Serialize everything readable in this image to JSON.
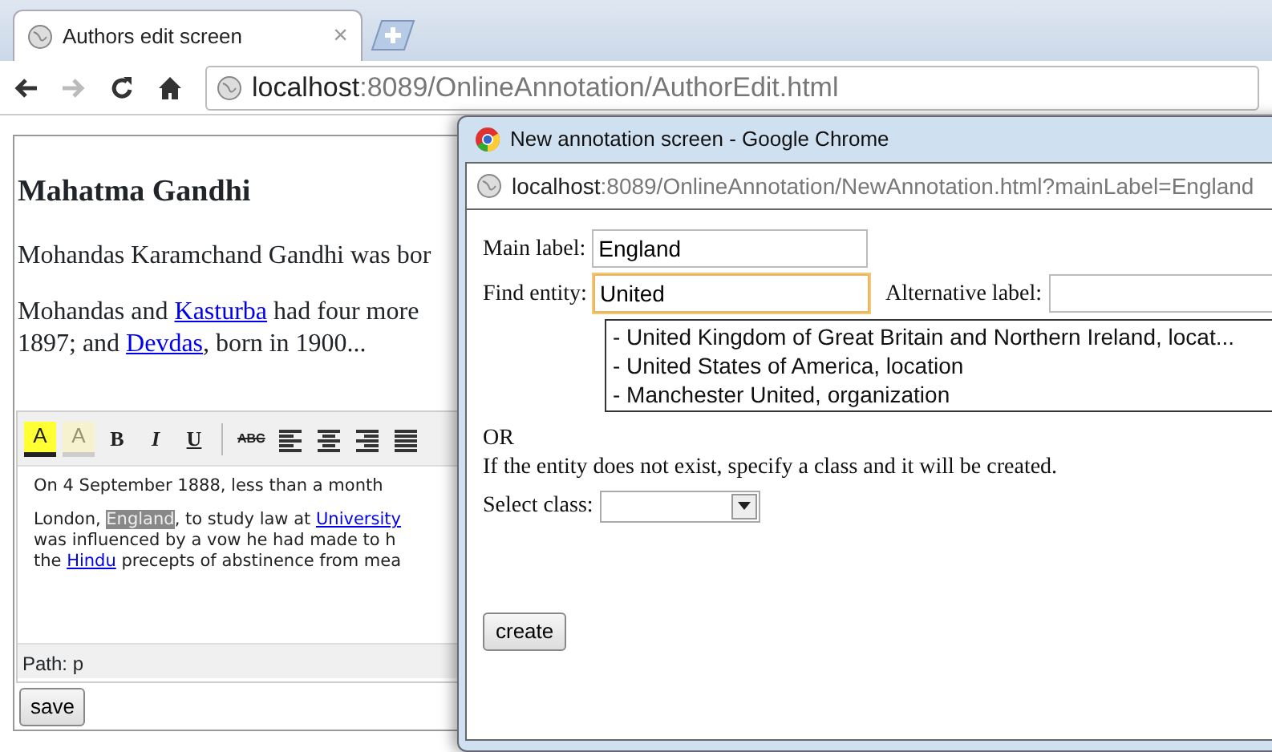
{
  "browser": {
    "tab": {
      "title": "Authors edit screen",
      "close": "×",
      "selected": true
    },
    "address": {
      "host": "localhost",
      "rest": ":8089/OnlineAnnotation/AuthorEdit.html"
    }
  },
  "page": {
    "heading": "Mahatma Gandhi",
    "paragraphs": [
      [
        [
          {
            "text": "Mohandas Karamchand Gandhi was bor"
          }
        ]
      ],
      [
        [
          {
            "text": "Mohandas and "
          },
          {
            "text": "Kasturba",
            "link": true
          },
          {
            "text": " had four more"
          }
        ],
        [
          {
            "text": "1897; and "
          },
          {
            "text": "Devdas",
            "link": true
          },
          {
            "text": ", born in 1900..."
          }
        ]
      ]
    ]
  },
  "editor": {
    "toolbar": [
      {
        "kind": "text-color",
        "label": "A"
      },
      {
        "kind": "highlight",
        "label": "A",
        "disabled": true
      },
      {
        "kind": "bold",
        "label": "B"
      },
      {
        "kind": "italic",
        "label": "I"
      },
      {
        "kind": "underline",
        "label": "U"
      },
      {
        "kind": "separator"
      },
      {
        "kind": "strikethrough",
        "label": "ABC"
      },
      {
        "kind": "align-left"
      },
      {
        "kind": "align-center"
      },
      {
        "kind": "align-right"
      },
      {
        "kind": "align-justify"
      }
    ],
    "paragraphs": [
      [
        [
          {
            "text": "On 4 September 1888, less than a month"
          }
        ]
      ],
      [
        [
          {
            "text": "London, "
          },
          {
            "text": "England",
            "selected": true
          },
          {
            "text": ", to study law at "
          },
          {
            "text": "University",
            "link": true
          }
        ],
        [
          {
            "text": "was influenced by a vow he had made to h"
          }
        ],
        [
          {
            "text": "the "
          },
          {
            "text": "Hindu",
            "link": true
          },
          {
            "text": " precepts of abstinence from mea"
          }
        ]
      ]
    ],
    "status": "Path: p",
    "save": "save"
  },
  "popup": {
    "title": "New annotation screen - Google Chrome",
    "address": {
      "host": "localhost",
      "rest": ":8089/OnlineAnnotation/NewAnnotation.html?mainLabel=England"
    },
    "main_label": {
      "label": "Main label:",
      "value": "England"
    },
    "find_entity": {
      "label": "Find entity:",
      "value": "United",
      "focused": true
    },
    "alternative_label": {
      "label": "Alternative label:"
    },
    "suggestions": [
      {
        "text": "- United Kingdom of Great Britain and Northern Ireland, locat..."
      },
      {
        "text": "- United States of America, location"
      },
      {
        "text": "- Manchester United, organization"
      }
    ],
    "or": "OR",
    "hint": "If the entity does not exist, specify a class and it will be created.",
    "select_class": {
      "label": "Select class:"
    },
    "create": "create"
  }
}
